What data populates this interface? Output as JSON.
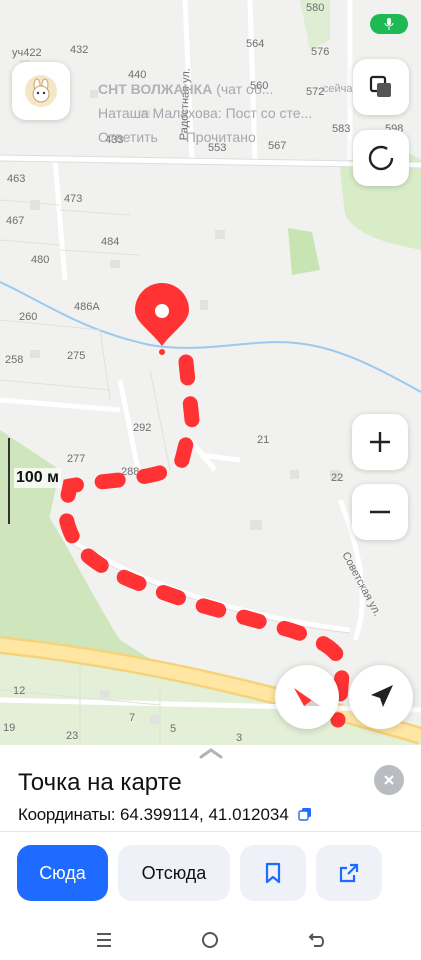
{
  "map": {
    "house_numbers": [
      {
        "id": "580",
        "text": "580"
      },
      {
        "id": "uch422",
        "text": "уч422"
      },
      {
        "id": "432",
        "text": "432"
      },
      {
        "id": "564",
        "text": "564"
      },
      {
        "id": "576",
        "text": "576"
      },
      {
        "id": "440",
        "text": "440"
      },
      {
        "id": "560",
        "text": "560"
      },
      {
        "id": "572",
        "text": "572"
      },
      {
        "id": "583",
        "text": "583"
      },
      {
        "id": "598",
        "text": "598"
      },
      {
        "id": "433",
        "text": "433"
      },
      {
        "id": "553",
        "text": "553"
      },
      {
        "id": "567",
        "text": "567"
      },
      {
        "id": "463",
        "text": "463"
      },
      {
        "id": "473",
        "text": "473"
      },
      {
        "id": "467",
        "text": "467"
      },
      {
        "id": "484",
        "text": "484"
      },
      {
        "id": "480",
        "text": "480"
      },
      {
        "id": "486A",
        "text": "486А"
      },
      {
        "id": "260",
        "text": "260"
      },
      {
        "id": "275",
        "text": "275"
      },
      {
        "id": "258",
        "text": "258"
      },
      {
        "id": "292",
        "text": "292"
      },
      {
        "id": "21",
        "text": "21"
      },
      {
        "id": "277",
        "text": "277"
      },
      {
        "id": "288",
        "text": "288"
      },
      {
        "id": "22",
        "text": "22"
      },
      {
        "id": "12",
        "text": "12"
      },
      {
        "id": "7",
        "text": "7"
      },
      {
        "id": "19",
        "text": "19"
      },
      {
        "id": "23",
        "text": "23"
      },
      {
        "id": "5",
        "text": "5"
      },
      {
        "id": "3",
        "text": "3"
      }
    ],
    "streets": {
      "radostnaya": "Радостная ул.",
      "sovetskaya": "Советская ул."
    },
    "scale_label": "100 м",
    "route_color": "#ff3333"
  },
  "notification": {
    "title": "СНТ ВОЛЖАНКА",
    "title_suffix": "(чат об...",
    "time": "сейчас",
    "message": "Наташа Малахова: Пост со сте...",
    "reply": "Ответить",
    "read": "Прочитано"
  },
  "sheet": {
    "title": "Точка на карте",
    "coords_label": "Координаты:",
    "coords_value": "64.399114, 41.012034",
    "buttons": {
      "here": "Сюда",
      "from_here": "Отсюда"
    }
  },
  "colors": {
    "accent": "#1f6bff",
    "mic": "#1db954"
  }
}
